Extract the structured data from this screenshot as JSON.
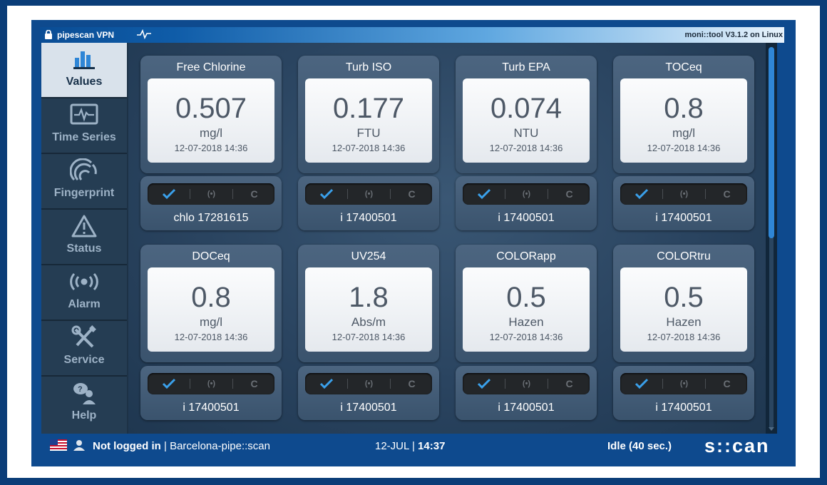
{
  "topbar": {
    "vpn_label": "pipescan VPN",
    "version": "moni::tool V3.1.2 on Linux"
  },
  "sidebar": {
    "items": [
      {
        "label": "Values",
        "icon": "bar-chart-icon",
        "active": true
      },
      {
        "label": "Time Series",
        "icon": "monitor-pulse-icon"
      },
      {
        "label": "Fingerprint",
        "icon": "fingerprint-icon"
      },
      {
        "label": "Status",
        "icon": "warning-icon"
      },
      {
        "label": "Alarm",
        "icon": "alarm-broadcast-icon"
      },
      {
        "label": "Service",
        "icon": "wrench-screwdriver-icon"
      },
      {
        "label": "Help",
        "icon": "help-chat-icon"
      }
    ]
  },
  "cards": [
    {
      "title": "Free Chlorine",
      "value": "0.507",
      "unit": "mg/l",
      "timestamp": "12-07-2018 14:36",
      "serial": "chlo 17281615"
    },
    {
      "title": "Turb ISO",
      "value": "0.177",
      "unit": "FTU",
      "timestamp": "12-07-2018 14:36",
      "serial": "i 17400501"
    },
    {
      "title": "Turb EPA",
      "value": "0.074",
      "unit": "NTU",
      "timestamp": "12-07-2018 14:36",
      "serial": "i 17400501"
    },
    {
      "title": "TOCeq",
      "value": "0.8",
      "unit": "mg/l",
      "timestamp": "12-07-2018 14:36",
      "serial": "i 17400501"
    },
    {
      "title": "DOCeq",
      "value": "0.8",
      "unit": "mg/l",
      "timestamp": "12-07-2018 14:36",
      "serial": "i 17400501"
    },
    {
      "title": "UV254",
      "value": "1.8",
      "unit": "Abs/m",
      "timestamp": "12-07-2018 14:36",
      "serial": "i 17400501"
    },
    {
      "title": "COLORapp",
      "value": "0.5",
      "unit": "Hazen",
      "timestamp": "12-07-2018 14:36",
      "serial": "i 17400501"
    },
    {
      "title": "COLORtru",
      "value": "0.5",
      "unit": "Hazen",
      "timestamp": "12-07-2018 14:36",
      "serial": "i 17400501"
    }
  ],
  "status_strip": {
    "check_symbol": "✔",
    "broadcast_symbol": "(•)",
    "cal_symbol": "C"
  },
  "bottombar": {
    "login_status": "Not logged in",
    "separator": " | ",
    "site": "Barcelona-pipe::scan",
    "date": "12-JUL",
    "time": "14:37",
    "idle": "Idle (40 sec.)",
    "brand": "s::can"
  },
  "colors": {
    "accent": "#2f86d6",
    "check": "#3aa0ea",
    "frame": "#0e4a8e"
  }
}
